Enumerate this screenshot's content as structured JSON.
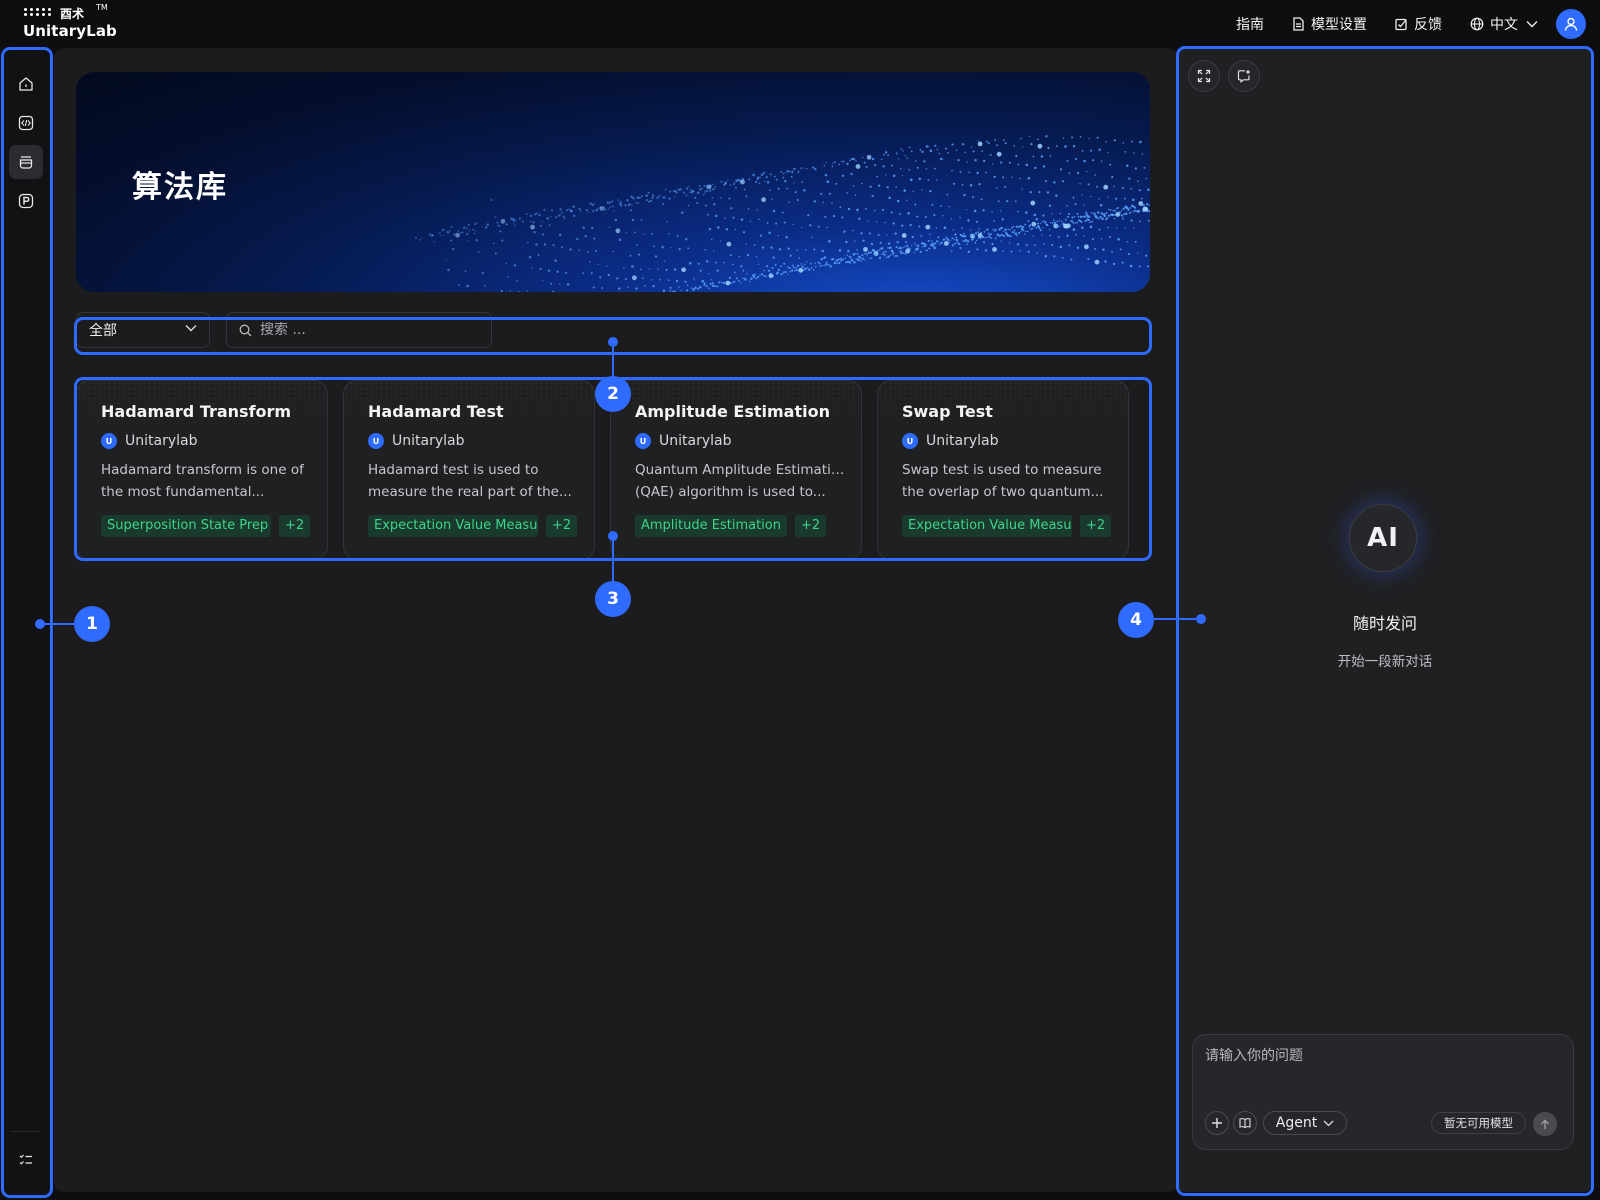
{
  "brand": {
    "cn": "酉术",
    "name": "UnitaryLab",
    "tm": "TM"
  },
  "topnav": {
    "guide": "指南",
    "model_settings": "模型设置",
    "feedback": "反馈",
    "language": "中文"
  },
  "sidebar": {
    "items": [
      {
        "icon": "home-icon"
      },
      {
        "icon": "code-icon"
      },
      {
        "icon": "library-icon",
        "active": true
      },
      {
        "icon": "p-icon"
      }
    ],
    "bottom_icon": "task-list-icon"
  },
  "banner": {
    "title": "算法库"
  },
  "filters": {
    "category_selected": "全部",
    "search_placeholder": "搜索 ..."
  },
  "cards": [
    {
      "title": "Hadamard Transform",
      "author": "Unitarylab",
      "desc_line1": "Hadamard transform is one of",
      "desc_line2": "the most fundamental...",
      "tag": "Superposition State Prep",
      "more": "+2"
    },
    {
      "title": "Hadamard Test",
      "author": "Unitarylab",
      "desc_line1": "Hadamard test is used to",
      "desc_line2": "measure the real part of the...",
      "tag": "Expectation Value Measu",
      "more": "+2"
    },
    {
      "title": "Amplitude Estimation",
      "author": "Unitarylab",
      "desc_line1": "Quantum Amplitude Estimation",
      "desc_line2": "(QAE) algorithm is used to...",
      "tag": "Amplitude Estimation",
      "more": "+2"
    },
    {
      "title": "Swap Test",
      "author": "Unitarylab",
      "desc_line1": "Swap test is used to measure",
      "desc_line2": "the overlap of two quantum...",
      "tag": "Expectation Value Measu",
      "more": "+2"
    }
  ],
  "ai_panel": {
    "logo_text": "AI",
    "title": "随时发问",
    "subtitle": "开始一段新对话",
    "input_placeholder": "请输入你的问题",
    "agent_label": "Agent",
    "model_status": "暂无可用模型"
  },
  "annotations": [
    "1",
    "2",
    "3",
    "4"
  ],
  "colors": {
    "accent": "#2f6bff",
    "tag_bg": "#193a2c",
    "tag_text": "#3fd38b",
    "panel_bg": "#1f2022",
    "main_bg": "#1c1c1e"
  }
}
